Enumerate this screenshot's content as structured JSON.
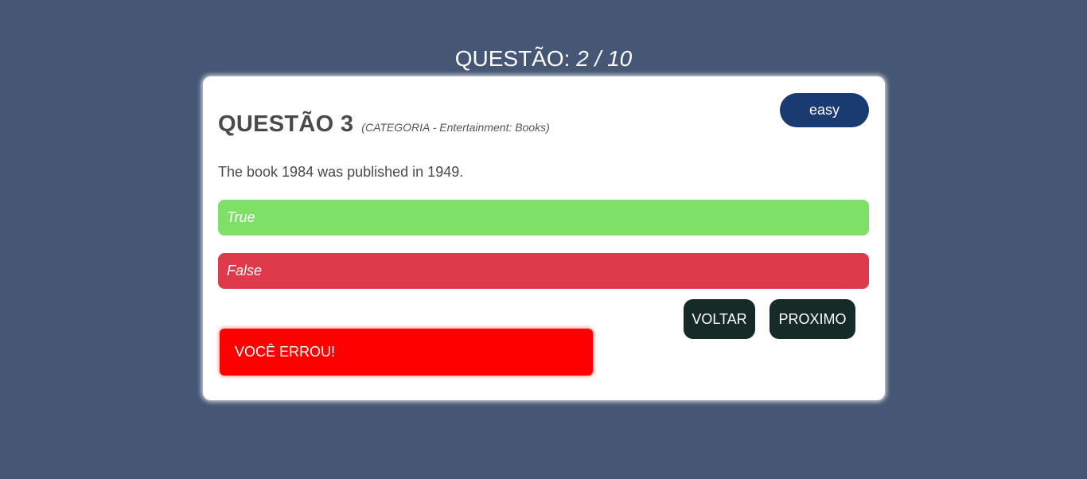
{
  "header": {
    "counter_label": "QUESTÃO:",
    "counter_value": "2 / 10"
  },
  "card": {
    "difficulty": "easy",
    "question_title": "QUESTÃO 3",
    "question_category": "(CATEGORIA - Entertainment: Books)",
    "question_text": "The book 1984 was published in 1949.",
    "answers": [
      {
        "label": "True",
        "color": "#7ee066",
        "state": "correct"
      },
      {
        "label": "False",
        "color": "#dd3b4b",
        "state": "incorrect"
      }
    ],
    "back_label": "VOLTAR",
    "next_label": "PROXIMO",
    "result_text": "VOCÊ ERROU!"
  },
  "colors": {
    "background": "#465775",
    "card": "#ffffff",
    "difficulty_badge": "#1a3a72",
    "nav_buttons": "#162b27",
    "result": "#ff0000"
  }
}
